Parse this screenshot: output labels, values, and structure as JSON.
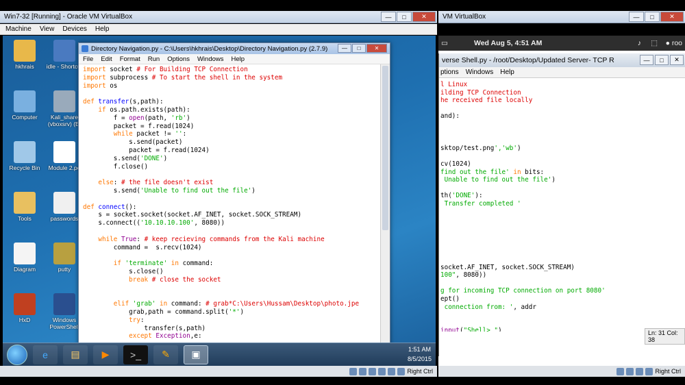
{
  "vbox_left": {
    "title": "Win7-32 [Running] - Oracle VM VirtualBox",
    "menu": [
      "Machine",
      "View",
      "Devices",
      "Help"
    ],
    "status": "Right Ctrl"
  },
  "vbox_right": {
    "title": "VM VirtualBox",
    "status": "Right Ctrl"
  },
  "desktop_icons": [
    {
      "label": "hkhrais",
      "icon": "user-folder-icon",
      "color": "#e8b84a"
    },
    {
      "label": "idle - Shortcut",
      "icon": "python-idle-icon",
      "color": "#4a7ac0"
    },
    {
      "label": "Computer",
      "icon": "computer-icon",
      "color": "#7ab0e0"
    },
    {
      "label": "Kali_share (vboxsrv) (E:",
      "icon": "network-drive-icon",
      "color": "#9ab"
    },
    {
      "label": "Recycle Bin",
      "icon": "recycle-bin-icon",
      "color": "#a0c8e8"
    },
    {
      "label": "Module 2.pe",
      "icon": "document-icon",
      "color": "#ffffff"
    },
    {
      "label": "Tools",
      "icon": "folder-icon",
      "color": "#e8c060"
    },
    {
      "label": "passwords",
      "icon": "text-file-icon",
      "color": "#f0f0f0"
    },
    {
      "label": "Diagram",
      "icon": "diagram-icon",
      "color": "#f4f4f4"
    },
    {
      "label": "putty",
      "icon": "putty-icon",
      "color": "#b8a040"
    },
    {
      "label": "HxD",
      "icon": "hxd-icon",
      "color": "#c04020"
    },
    {
      "label": "Windows PowerShell",
      "icon": "powershell-icon",
      "color": "#2a4f8f"
    }
  ],
  "idle": {
    "title": "Directory Navigation.py - C:\\Users\\hkhrais\\Desktop\\Directory Navigation.py (2.7.9)",
    "menu": [
      "File",
      "Edit",
      "Format",
      "Run",
      "Options",
      "Windows",
      "Help"
    ]
  },
  "taskbar": {
    "time": "1:51 AM",
    "date": "8/5/2015",
    "buttons": [
      "explorer-icon",
      "ie-icon",
      "folder-icon",
      "media-player-icon",
      "cmd-icon",
      "pencil-icon",
      "idle-window-icon"
    ]
  },
  "kali": {
    "datetime": "Wed Aug  5,  4:51 AM",
    "window_title": "verse Shell.py - /root/Desktop/Updated Server- TCP R",
    "menu": [
      "ptions",
      "Windows",
      "Help"
    ],
    "status": "Ln: 31 Col: 38"
  }
}
